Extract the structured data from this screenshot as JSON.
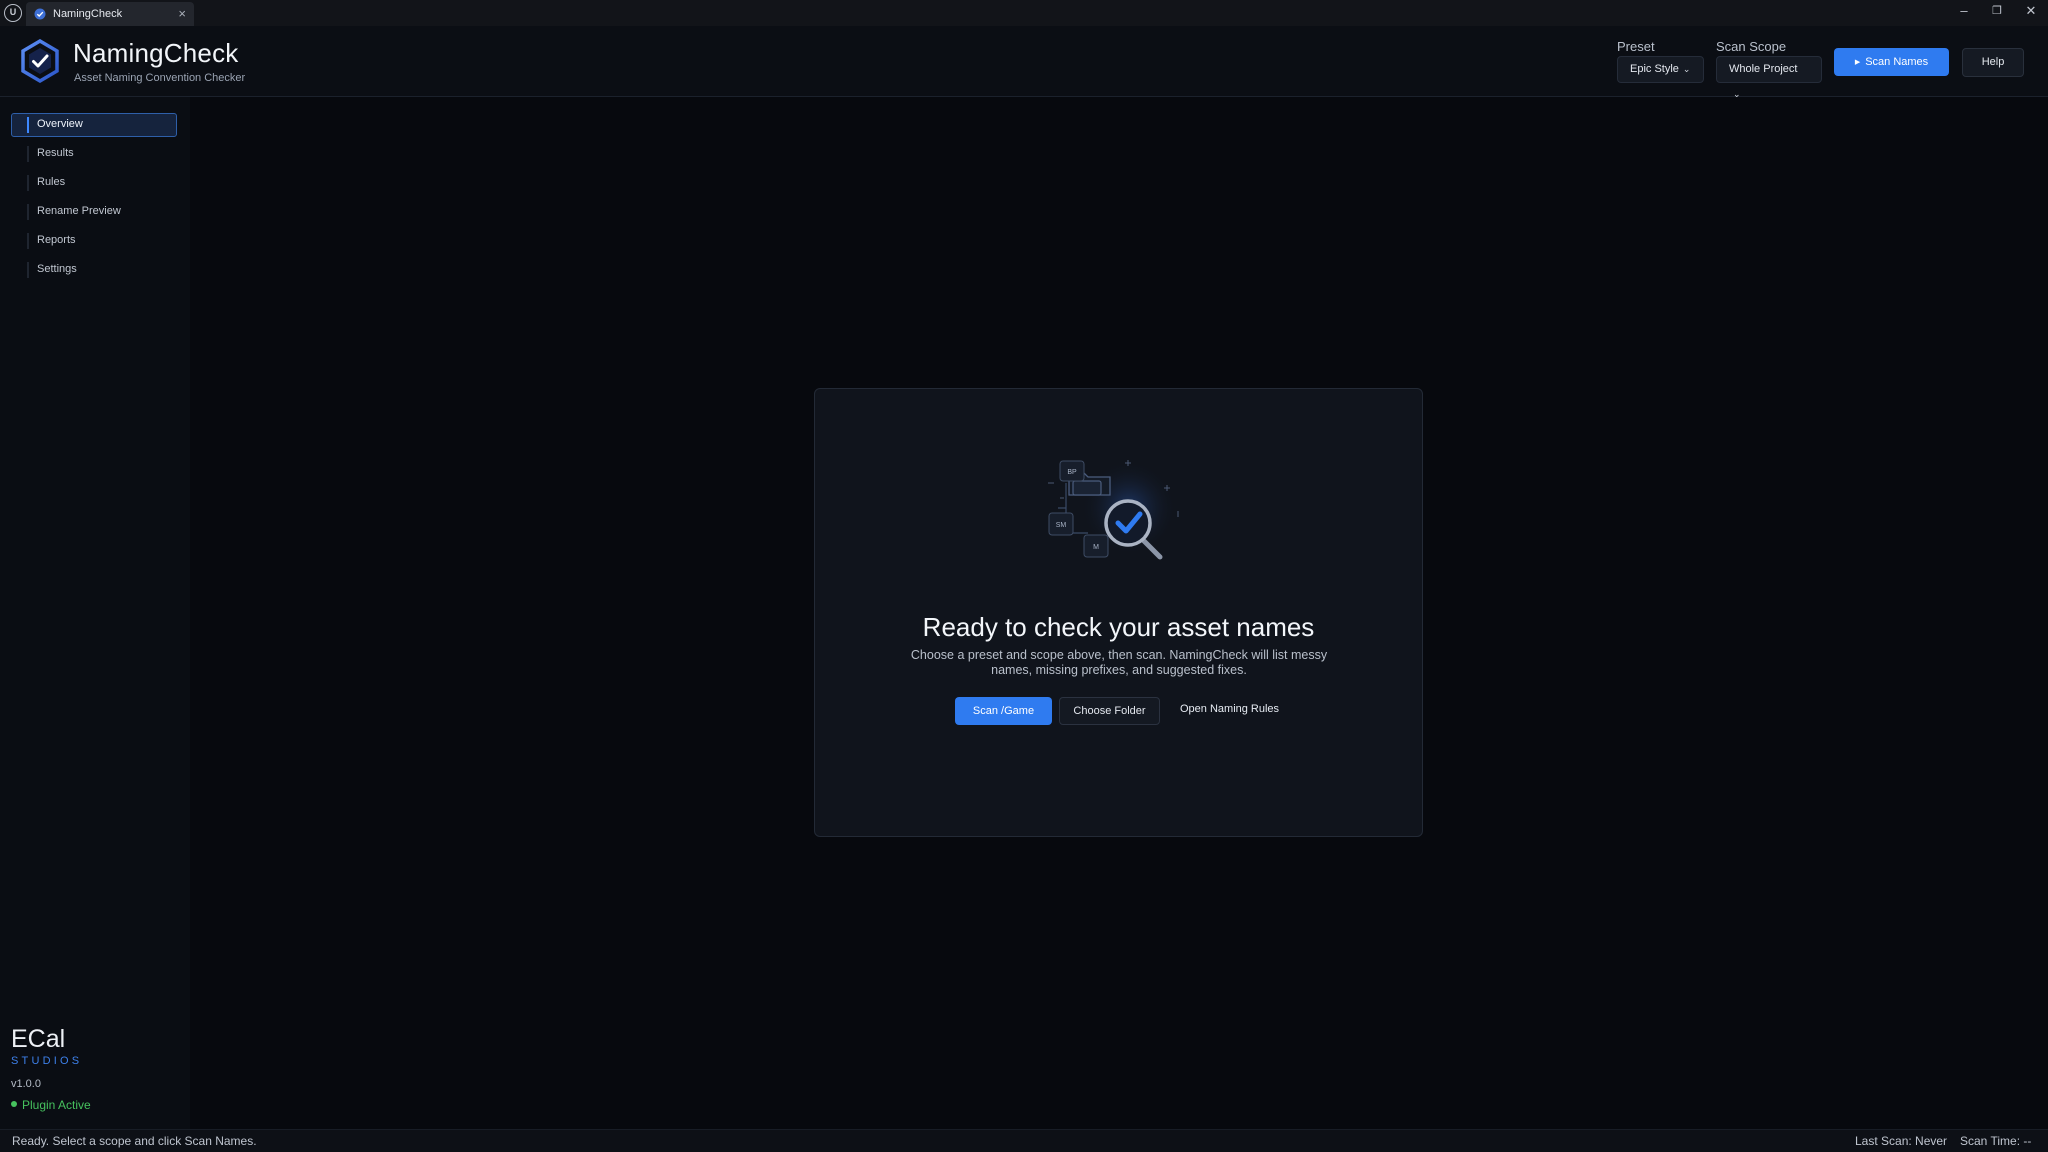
{
  "titlebar": {
    "tab_label": "NamingCheck",
    "tab_close": "×",
    "minimize": "–",
    "restore": "❐",
    "close": "✕",
    "engine_logo": "U"
  },
  "header": {
    "title": "NamingCheck",
    "subtitle": "Asset Naming Convention Checker",
    "preset": {
      "label": "Preset",
      "value": "Epic Style"
    },
    "scope": {
      "label": "Scan Scope",
      "value": "Whole Project"
    },
    "scan_button": "Scan Names",
    "help_button": "Help"
  },
  "sidebar": {
    "items": [
      {
        "label": "Overview",
        "active": true
      },
      {
        "label": "Results"
      },
      {
        "label": "Rules"
      },
      {
        "label": "Rename Preview"
      },
      {
        "label": "Reports"
      },
      {
        "label": "Settings"
      }
    ],
    "brand": "ECal",
    "brand_sub": "STUDIOS",
    "version": "v1.0.0",
    "plugin_status": "Plugin Active"
  },
  "card": {
    "title": "Ready to check your asset names",
    "description": "Choose a preset and scope above, then scan. NamingCheck will list messy names, missing prefixes, and suggested fixes.",
    "scan_game_button": "Scan /Game",
    "choose_folder_button": "Choose Folder",
    "open_rules_link": "Open Naming Rules",
    "illustration_tags": [
      "BP",
      "SM",
      "M"
    ]
  },
  "statusbar": {
    "message": "Ready. Select a scope and click Scan Names.",
    "last_scan": "Last Scan: Never",
    "scan_time": "Scan Time: --"
  },
  "colors": {
    "accent": "#2f7bf0",
    "active_green": "#46c25e",
    "background": "#07090e"
  },
  "icons": {
    "app_logo": "hexagon-check-icon",
    "illustration": "magnifier-check-icon"
  }
}
